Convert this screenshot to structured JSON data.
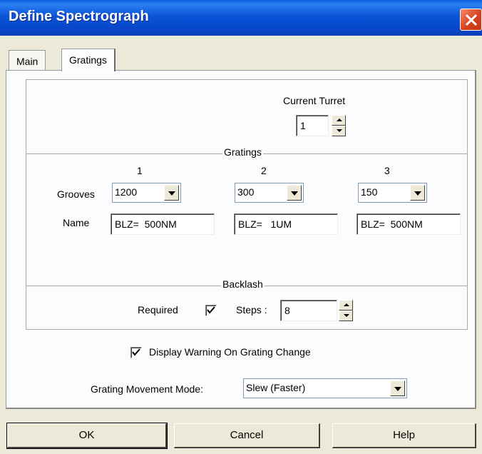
{
  "window": {
    "title": "Define Spectrograph"
  },
  "tabs": [
    {
      "label": "Main"
    },
    {
      "label": "Gratings"
    }
  ],
  "turret": {
    "label": "Current Turret",
    "value": "1"
  },
  "gratings": {
    "legend": "Gratings",
    "grooves_label": "Grooves",
    "name_label": "Name",
    "columns": [
      {
        "header": "1",
        "grooves": "1200",
        "name": "BLZ=  500NM"
      },
      {
        "header": "2",
        "grooves": "300",
        "name": "BLZ=   1UM"
      },
      {
        "header": "3",
        "grooves": "150",
        "name": "BLZ=  500NM"
      }
    ]
  },
  "backlash": {
    "legend": "Backlash",
    "required_label": "Required",
    "required_checked": true,
    "steps_label": "Steps :",
    "steps_value": "8"
  },
  "display_warning": {
    "label": "Display Warning On Grating Change",
    "checked": true
  },
  "movement_mode": {
    "label": "Grating Movement Mode:",
    "value": "Slew (Faster)"
  },
  "buttons": {
    "ok": "OK",
    "cancel": "Cancel",
    "help": "Help"
  }
}
